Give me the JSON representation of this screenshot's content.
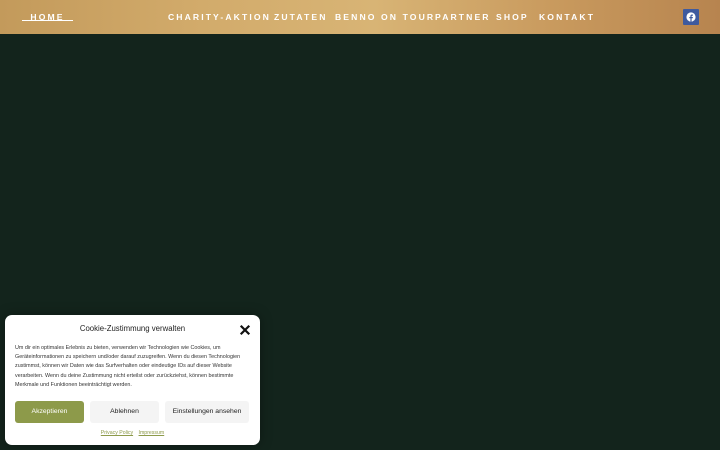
{
  "nav": {
    "items": [
      {
        "label": "HOME",
        "active": true
      },
      {
        "label": "CHARITY-AKTION"
      },
      {
        "label": "ZUTATEN"
      },
      {
        "label": "BENNO ON TOUR"
      },
      {
        "label": "PARTNER"
      },
      {
        "label": "SHOP"
      },
      {
        "label": "KONTAKT"
      }
    ],
    "social_icon": "facebook-icon"
  },
  "cookie": {
    "title": "Cookie-Zustimmung verwalten",
    "text": "Um dir ein optimales Erlebnis zu bieten, verwenden wir Technologien wie Cookies, um Geräteinformationen zu speichern und/oder darauf zuzugreifen. Wenn du diesen Technologien zustimmst, können wir Daten wie das Surfverhalten oder eindeutige IDs auf dieser Website verarbeiten. Wenn du deine Zustimmung nicht erteilst oder zurückziehst, können bestimmte Merkmale und Funktionen beeinträchtigt werden.",
    "accept_label": "Akzeptieren",
    "decline_label": "Ablehnen",
    "settings_label": "Einstellungen ansehen",
    "privacy_link": "Privacy Policy",
    "imprint_link": "Impressum"
  },
  "colors": {
    "background": "#13241c",
    "nav_gold": "#d2ab6b",
    "accent": "#8d9a4a",
    "facebook": "#3f5a9e"
  }
}
